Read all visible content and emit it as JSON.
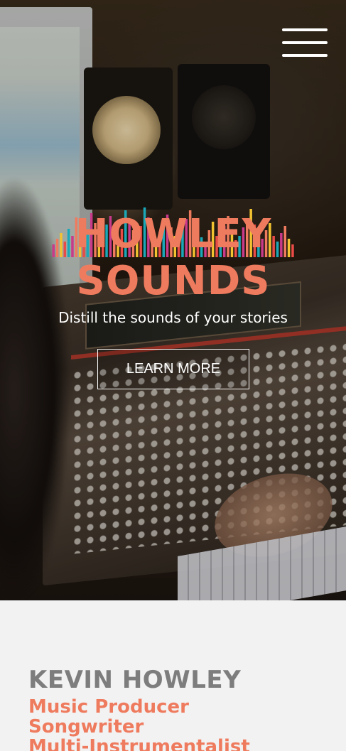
{
  "hero": {
    "logo": {
      "line1": "HOWLEY",
      "line2": "SOUNDS",
      "colors": [
        "#ef7b5e",
        "#1aa8b8",
        "#f2c230",
        "#c93a8a",
        "#e94b46"
      ]
    },
    "tagline": "Distill the sounds of your stories",
    "cta_label": "LEARN MORE",
    "menu_icon": "hamburger-menu-icon"
  },
  "about": {
    "name": "KEVIN HOWLEY",
    "roles": [
      "Music Producer",
      "Songwriter",
      "Multi-Instrumentalist"
    ]
  },
  "colors": {
    "accent": "#ef7b5e",
    "name_gray": "#7d7d7d",
    "section_bg": "#f2f2f2"
  }
}
